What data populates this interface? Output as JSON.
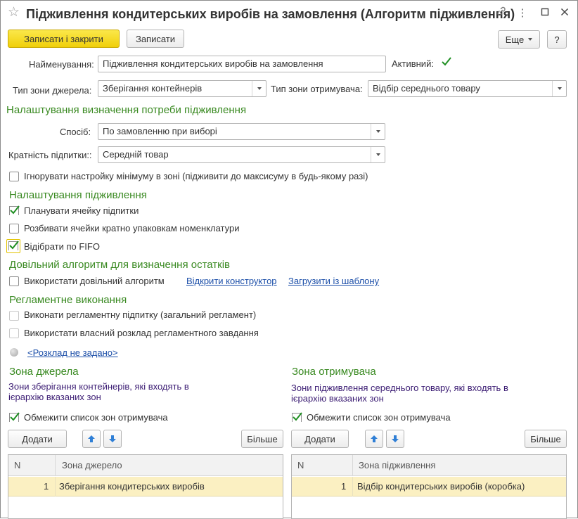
{
  "window": {
    "title": "Підживлення кондитерських виробів на замовлення (Алгоритм підживлення)"
  },
  "toolbar": {
    "save_close": "Записати і закрити",
    "save": "Записати",
    "more": "Еще",
    "help": "?"
  },
  "form": {
    "name_label": "Найменування:",
    "name_value": "Підживлення кондитерських виробів на замовлення",
    "active_label": "Активний:",
    "active_checked": true,
    "source_zone_type_label": "Тип зони джерела:",
    "source_zone_type_value": "Зберігання контейнерів",
    "target_zone_type_label": "Тип зони отримувача:",
    "target_zone_type_value": "Відбір середнього товару"
  },
  "need_section": {
    "title": "Налаштування визначення потреби підживлення",
    "method_label": "Спосіб:",
    "method_value": "По замовленню при виборі",
    "multiplicity_label": "Кратність підпитки::",
    "multiplicity_value": "Середній товар",
    "ignore_min_label": "Ігнорувати настройку мінімуму в зоні (підживити до максисуму в будь-якому разі)",
    "ignore_min_checked": false
  },
  "replenish_section": {
    "title": "Налаштування підживлення",
    "plan_cell_label": "Планувати ячейку підпитки",
    "plan_cell_checked": true,
    "split_cells_label": "Розбивати ячейки кратно упаковкам номенклатури",
    "split_cells_checked": false,
    "fifo_label": "Відібрати по FIFO",
    "fifo_checked": true
  },
  "custom_algo_section": {
    "title": "Довільний алгоритм для визначення остатків",
    "use_custom_label": "Використати довільний алгоритм",
    "use_custom_checked": false,
    "open_constructor": "Відкрити конструктор",
    "load_template": "Загрузити із шаблону"
  },
  "routine_section": {
    "title": "Регламентне виконання",
    "run_routine_label": "Виконати регламентну підпитку (загальний регламент)",
    "own_schedule_label": "Використати власний розклад регламентного завдання",
    "schedule_link": "<Розклад не задано>"
  },
  "source_zone": {
    "title": "Зона джерела",
    "description": "Зони зберігання контейнерів, які входять в ієрархію вказаних зон",
    "limit_label": "Обмежити список зон отримувача",
    "limit_checked": true,
    "add_button": "Додати",
    "more_button": "Більше",
    "col_n": "N",
    "col_zone": "Зона джерело",
    "rows": [
      {
        "n": "1",
        "zone": "Зберігання кондитерських виробів"
      }
    ]
  },
  "target_zone": {
    "title": "Зона отримувача",
    "description": "Зони підживлення середнього товару, які входять в ієрархію вказаних зон",
    "limit_label": "Обмежити список зон отримувача",
    "limit_checked": true,
    "add_button": "Додати",
    "more_button": "Більше",
    "col_n": "N",
    "col_zone": "Зона підживлення",
    "rows": [
      {
        "n": "1",
        "zone": "Відбір кондитерських виробів (коробка)"
      }
    ]
  },
  "colors": {
    "section_green": "#3a8a22",
    "description_purple": "#3b1c73",
    "link_blue": "#1b4ea8",
    "primary_yellow": "#f0cf0a",
    "selected_row": "#fbf0c2",
    "checkmark": "#1f8f22"
  },
  "icons": {
    "star": "star-icon",
    "link": "link-icon",
    "menu": "more-vertical-icon",
    "maximize": "maximize-icon",
    "close": "close-icon",
    "up": "arrow-up-icon",
    "down": "arrow-down-icon",
    "dropdown": "chevron-down-icon"
  }
}
